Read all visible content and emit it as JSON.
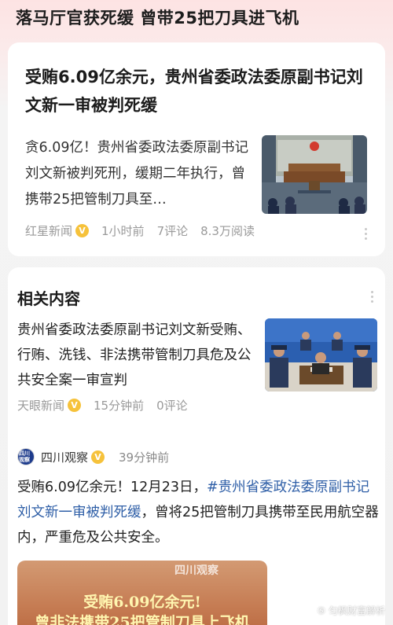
{
  "top_title": "落马厅官获死缓 曾带25把刀具进飞机",
  "main_article": {
    "headline": "受贿6.09亿余元，贵州省委政法委原副书记刘文新一审被判死缓",
    "summary": "贪6.09亿！贵州省委政法委原副书记刘文新被判死刑，缓期二年执行，曾携带25把管制刀具至…",
    "source": "红星新闻",
    "verified_badge": "V",
    "time": "1小时前",
    "comments": "7评论",
    "reads": "8.3万阅读",
    "thumbnail_icon": "courtroom-photo"
  },
  "related": {
    "section_title": "相关内容",
    "item": {
      "title": "贵州省委政法委原副书记刘文新受贿、行贿、洗钱、非法携带管制刀具危及公共安全案一审宣判",
      "source": "天眼新闻",
      "verified_badge": "V",
      "time": "15分钟前",
      "comments": "0评论",
      "thumbnail_icon": "defendant-photo"
    }
  },
  "post": {
    "avatar_text": "四川观察",
    "author": "四川观察",
    "verified_badge": "V",
    "time": "39分钟前",
    "body_prefix": "受贿6.09亿余元！12月23日，",
    "body_tag": "#贵州省委政法委原副书记刘文新一审被判死缓",
    "body_suffix": "，曾将25把管制刀具携带至民用航空器内，严重危及公共安全。",
    "video_watermark": "四川观察",
    "video_line1": "受贿6.09亿余元!",
    "video_line2": "曾非法携带25把管制刀具上飞机"
  },
  "corner_watermark": "⑤ 匀枫财富解析",
  "colors": {
    "tag_blue": "#2f5fa7",
    "badge_yellow": "#f6c23b",
    "meta_gray": "#9a9a9a"
  }
}
